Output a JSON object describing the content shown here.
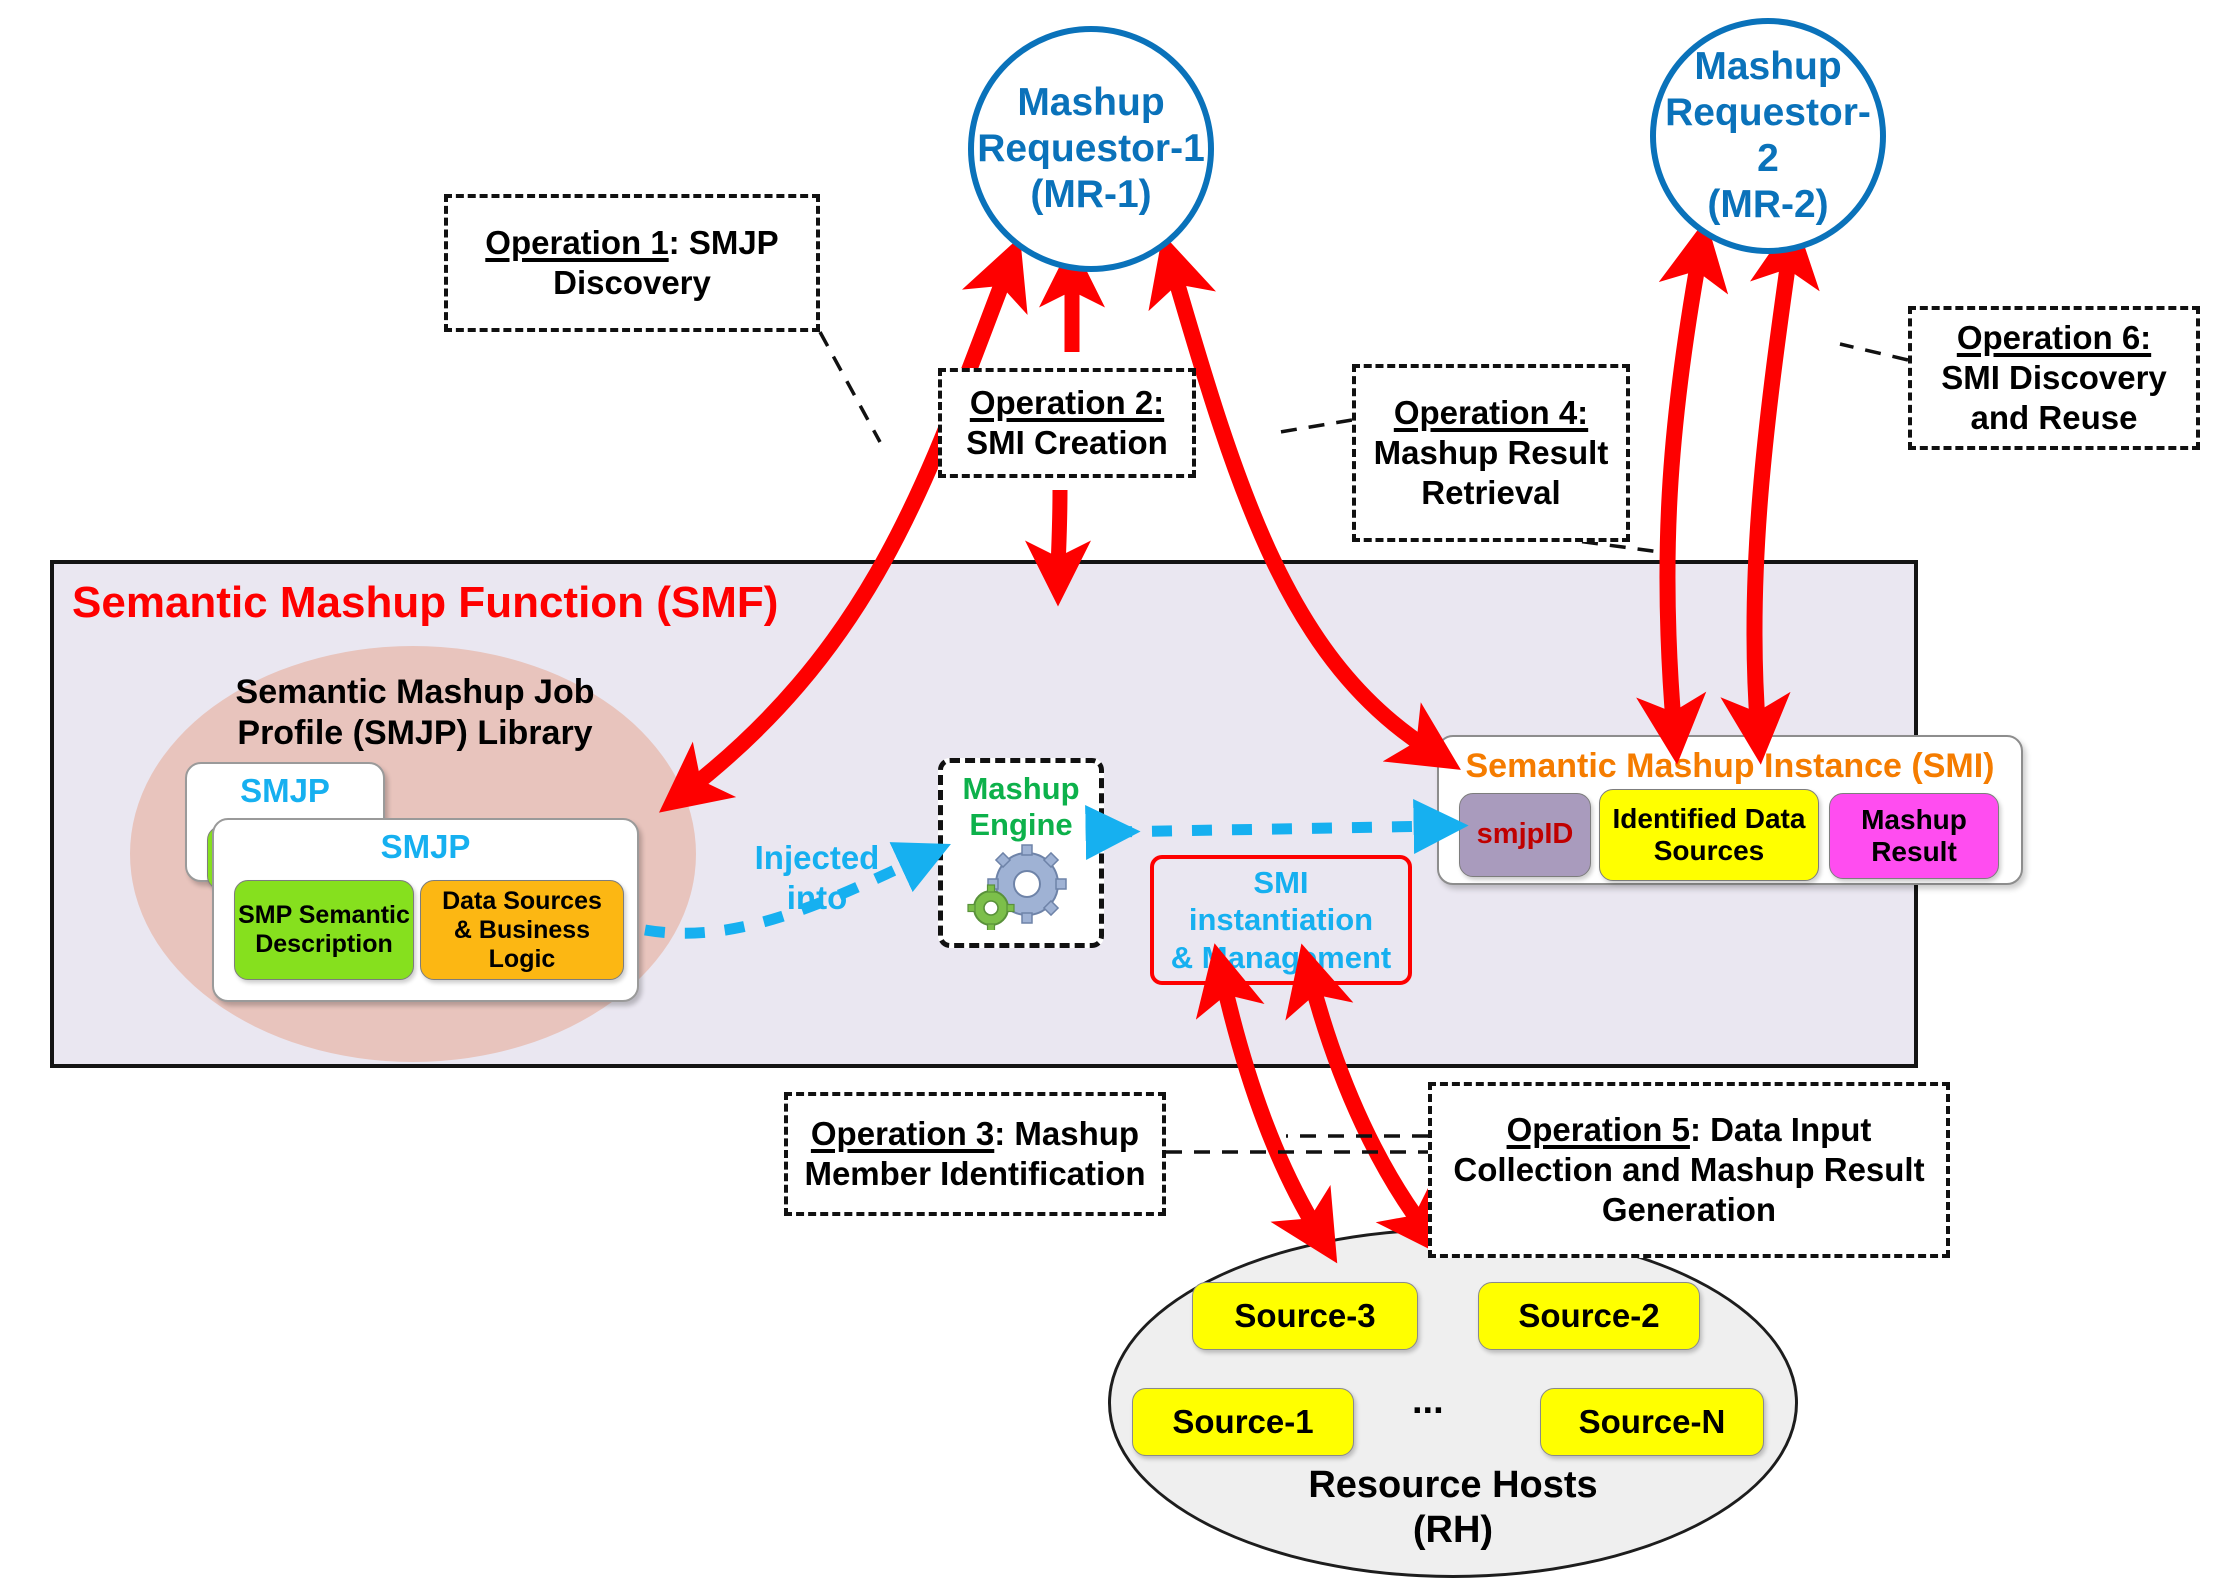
{
  "requestors": [
    {
      "id": "mr1",
      "lines": [
        "Mashup",
        "Requestor-1",
        "(MR-1)"
      ]
    },
    {
      "id": "mr2",
      "lines": [
        "Mashup",
        "Requestor-2",
        "(MR-2)"
      ]
    }
  ],
  "callouts": [
    {
      "id": "op1",
      "head": "Operation 1",
      "rest": ": SMJP",
      "tail": "Discovery"
    },
    {
      "id": "op2",
      "head": "Operation 2:",
      "rest": "",
      "tail": "SMI Creation"
    },
    {
      "id": "op4",
      "head": "Operation 4:",
      "rest": "",
      "tail": "Mashup Result Retrieval"
    },
    {
      "id": "op6",
      "head": "Operation 6:",
      "rest": "",
      "tail": "SMI Discovery and Reuse"
    },
    {
      "id": "op3",
      "head": "Operation 3",
      "rest": ": Mashup",
      "tail": "Member Identification"
    },
    {
      "id": "op5",
      "head": "Operation 5",
      "rest": ": Data Input",
      "tail": "Collection and Mashup Result Generation"
    }
  ],
  "smf": {
    "title": "Semantic Mashup Function (SMF)",
    "title_color": "#fe0000",
    "background": "#eae7f1"
  },
  "smjp_library": {
    "title_line1": "Semantic Mashup Job",
    "title_line2": "Profile (SMJP) Library",
    "ellipse_color": "#e8c4bd",
    "card_back_label": "SMJP",
    "card_front_label": "SMJP",
    "card_label_color": "#16b0f0",
    "chips": [
      {
        "id": "smp-semantic",
        "line1": "SMP Semantic",
        "line2": "Description",
        "color": "#86e01e"
      },
      {
        "id": "data-sources",
        "line1": "Data Sources",
        "line2": "& Business Logic",
        "color": "#fcb713"
      }
    ]
  },
  "mashup_engine": {
    "line1": "Mashup",
    "line2": "Engine",
    "color": "#0db14b",
    "icon": "gears-icon"
  },
  "injected_label": {
    "line1": "Injected",
    "line2": "into",
    "color": "#16b0f0"
  },
  "smi_instantiation": {
    "line1": "SMI",
    "line2": "instantiation",
    "line3": "& Management",
    "text_color": "#16b0f0",
    "border_color": "#fe0000"
  },
  "smi_panel": {
    "title": "Semantic Mashup Instance (SMI)",
    "title_color": "#f57c00",
    "items": [
      {
        "id": "smjpid",
        "label": "smjpID",
        "bg": "#a99bbd",
        "fg": "#c00000"
      },
      {
        "id": "identified-data-sources",
        "line1": "Identified Data",
        "line2": "Sources",
        "bg": "#ffff00",
        "fg": "#000000"
      },
      {
        "id": "mashup-result",
        "line1": "Mashup",
        "line2": "Result",
        "bg": "#ff4df0",
        "fg": "#000000"
      }
    ]
  },
  "resource_hosts": {
    "title_line1": "Resource Hosts",
    "title_line2": "(RH)",
    "dots": "...",
    "sources": [
      {
        "id": "source-3",
        "label": "Source-3"
      },
      {
        "id": "source-2",
        "label": "Source-2"
      },
      {
        "id": "source-1",
        "label": "Source-1"
      },
      {
        "id": "source-n",
        "label": "Source-N"
      }
    ],
    "chip_color": "#ffff00",
    "ellipse_color": "#efefef"
  },
  "arrow_color": "#fe0000",
  "dashed_flow_color": "#16b0f0"
}
